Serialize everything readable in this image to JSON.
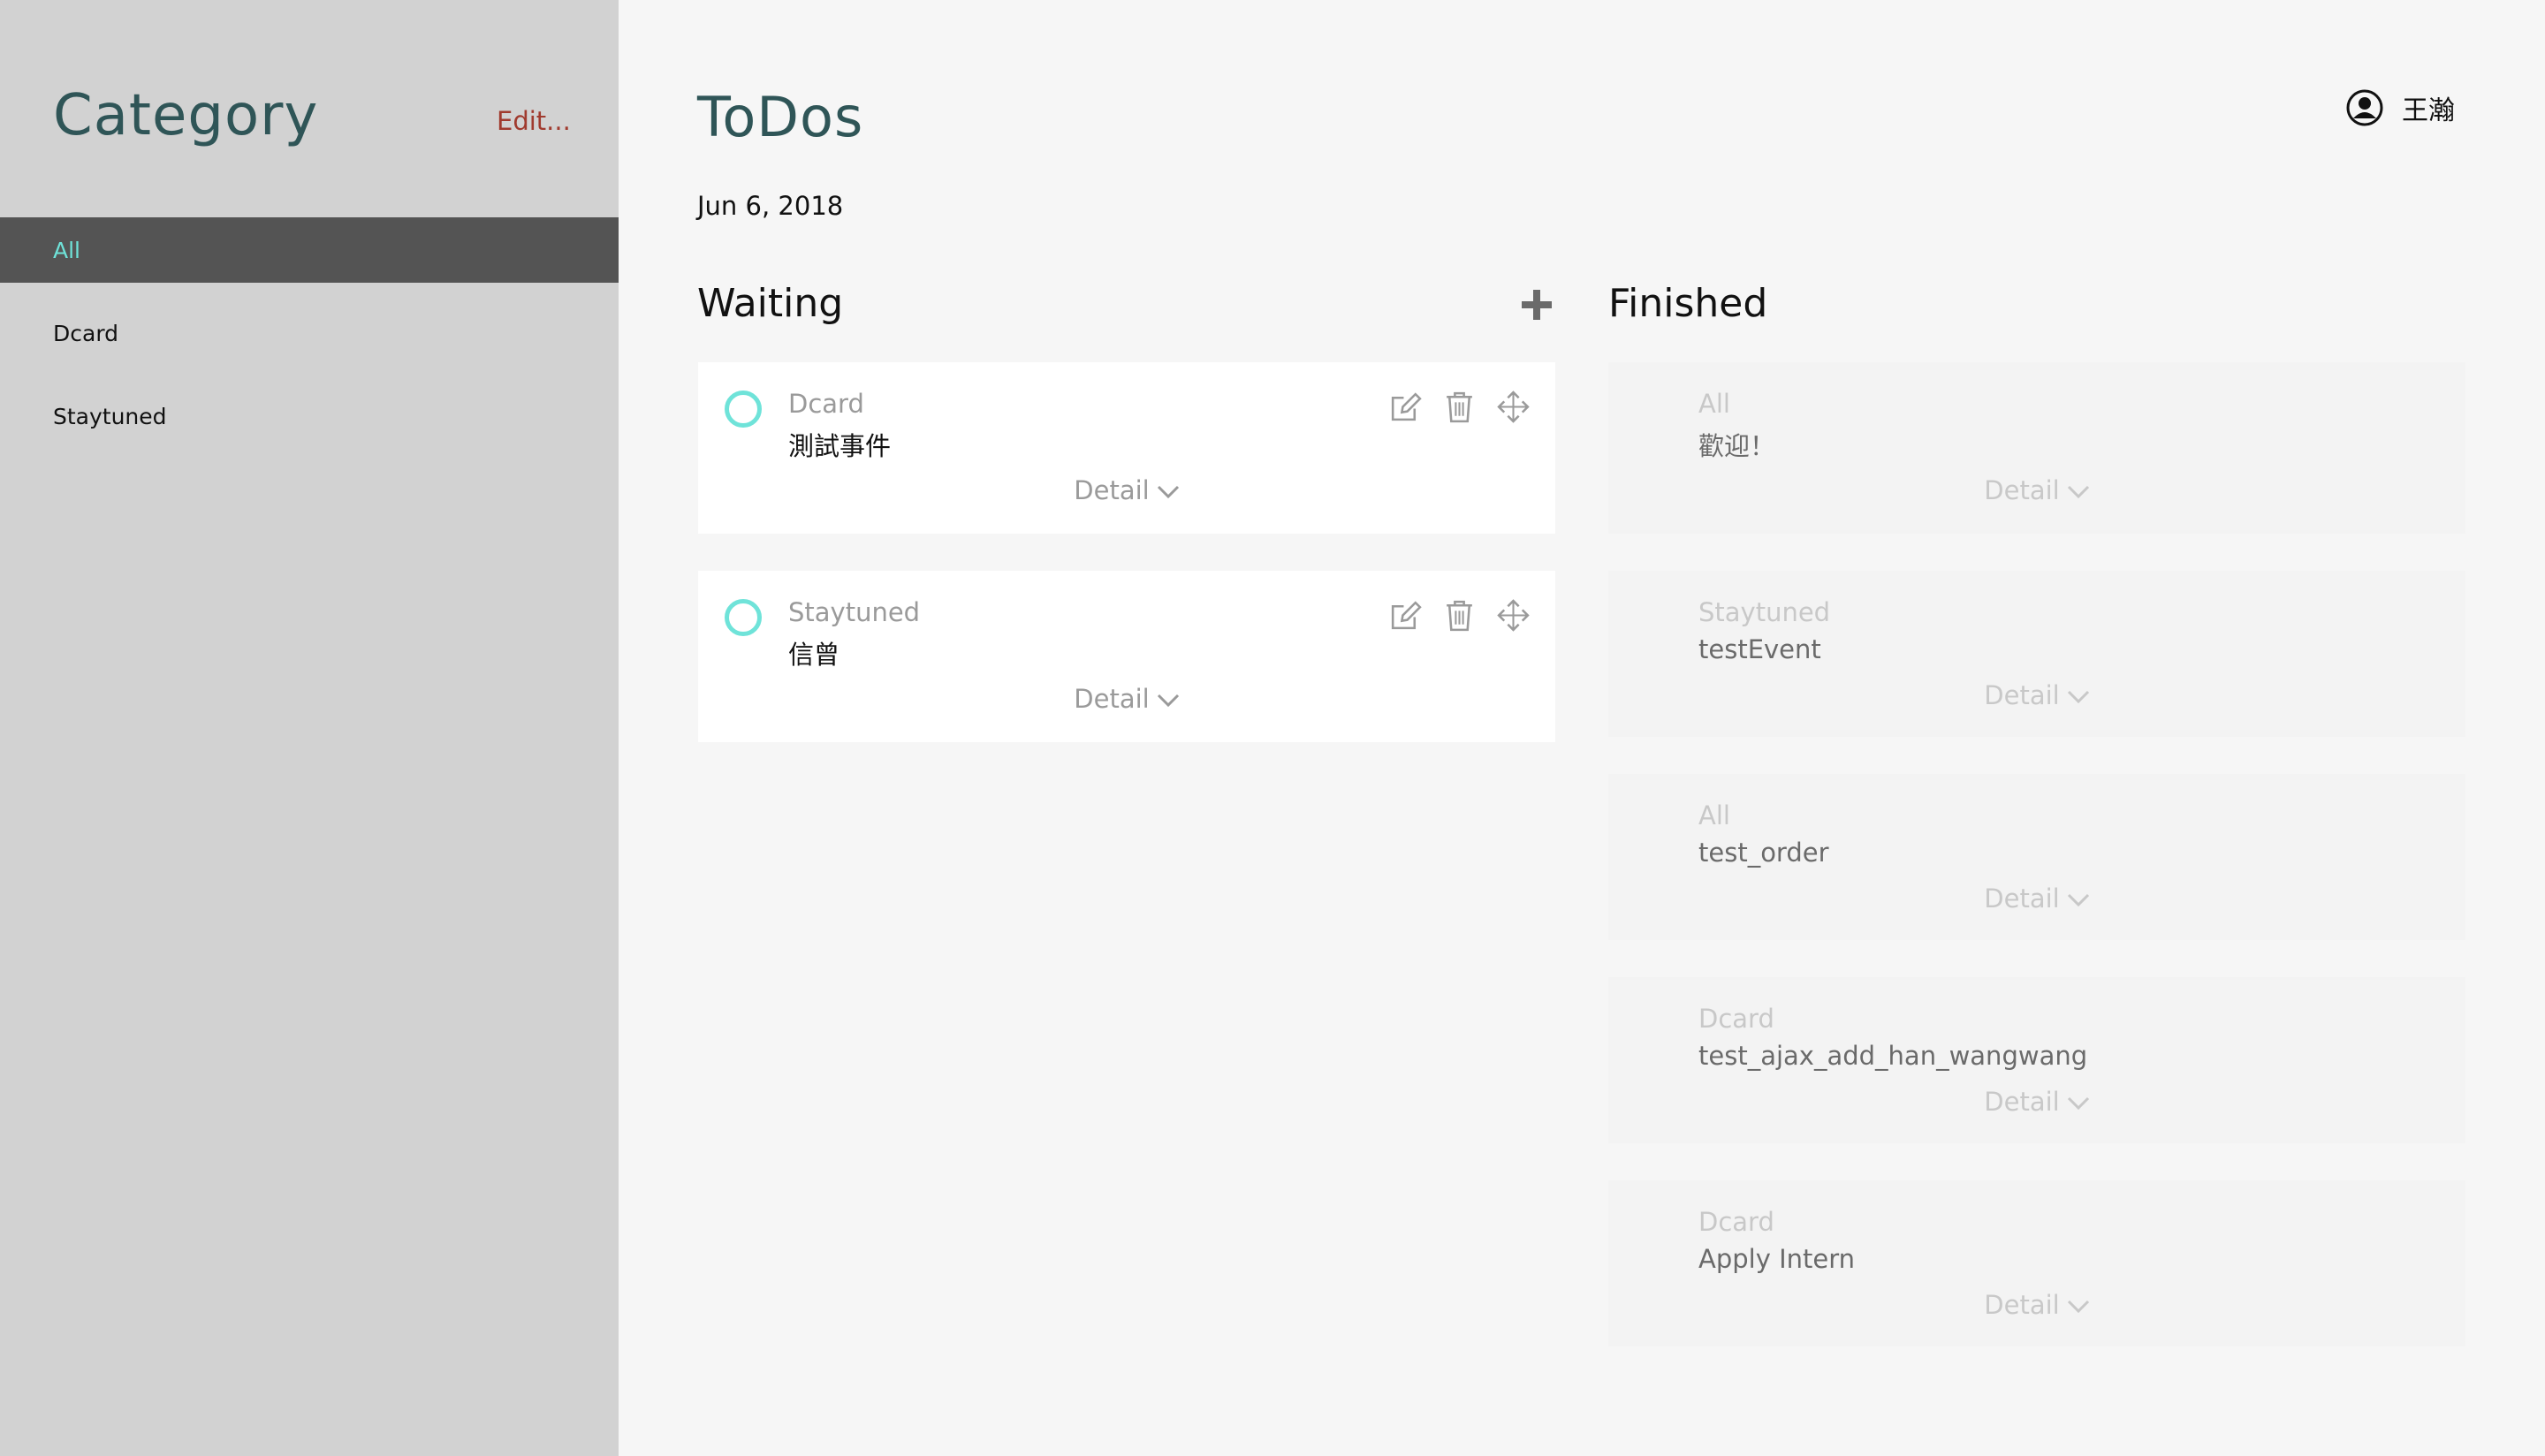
{
  "sidebar": {
    "title": "Category",
    "edit_label": "Edit...",
    "items": [
      {
        "label": "All",
        "active": true
      },
      {
        "label": "Dcard"
      },
      {
        "label": "Staytuned"
      }
    ]
  },
  "main": {
    "title": "ToDos",
    "date": "Jun 6, 2018"
  },
  "user": {
    "name": "王瀚",
    "icon": "user-icon"
  },
  "waiting": {
    "title": "Waiting",
    "add_icon": "plus-icon",
    "items": [
      {
        "category": "Dcard",
        "name": "測試事件",
        "detail": "Detail"
      },
      {
        "category": "Staytuned",
        "name": "信曾",
        "detail": "Detail"
      }
    ]
  },
  "finished": {
    "title": "Finished",
    "items": [
      {
        "category": "All",
        "name": "歡迎！",
        "detail": "Detail"
      },
      {
        "category": "Staytuned",
        "name": "testEvent",
        "detail": "Detail"
      },
      {
        "category": "All",
        "name": "test_order",
        "detail": "Detail"
      },
      {
        "category": "Dcard",
        "name": "test_ajax_add_han_wangwang",
        "detail": "Detail"
      },
      {
        "category": "Dcard",
        "name": "Apply Intern",
        "detail": "Detail"
      }
    ]
  },
  "colors": {
    "accent": "#6fe3d9",
    "title": "#2f5557",
    "edit": "#a03a2e",
    "sidebar_bg": "#d2d2d2",
    "active_bg": "#545454"
  }
}
